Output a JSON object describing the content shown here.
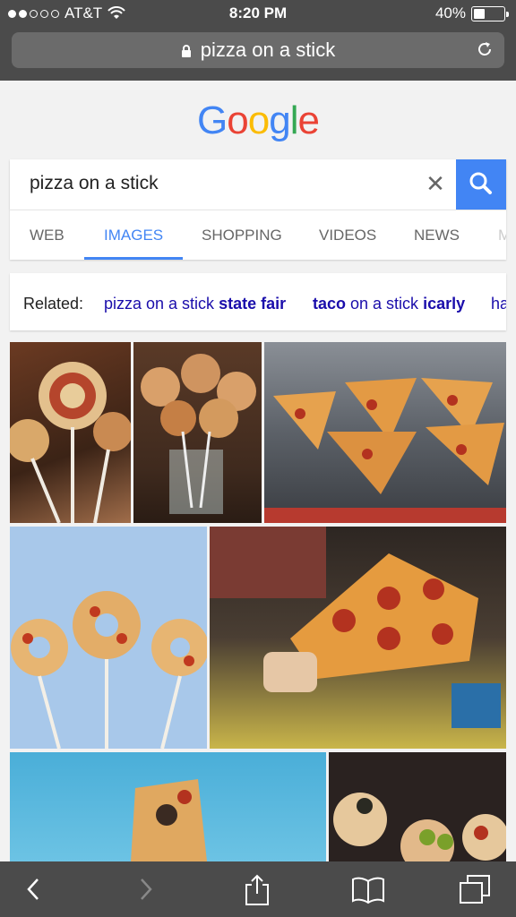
{
  "status": {
    "carrier": "AT&T",
    "time": "8:20 PM",
    "battery": "40%",
    "battery_level": 0.4
  },
  "url": {
    "text": "pizza on a stick"
  },
  "logo": {
    "letters": [
      "G",
      "o",
      "o",
      "g",
      "l",
      "e"
    ],
    "colors": [
      "#4285f4",
      "#ea4335",
      "#fbbc05",
      "#4285f4",
      "#34a853",
      "#ea4335"
    ]
  },
  "search": {
    "query": "pizza on a stick",
    "clear_icon": "close-icon",
    "search_icon": "search-icon"
  },
  "tabs": [
    {
      "label": "WEB",
      "active": false
    },
    {
      "label": "IMAGES",
      "active": true
    },
    {
      "label": "SHOPPING",
      "active": false
    },
    {
      "label": "VIDEOS",
      "active": false
    },
    {
      "label": "NEWS",
      "active": false
    },
    {
      "label": "M",
      "active": false
    }
  ],
  "related": {
    "label": "Related:",
    "items": [
      {
        "plain": "pizza on a stick ",
        "bold": "state fair"
      },
      {
        "bold_first": "taco",
        "plain": " on a stick ",
        "bold": "icarly"
      },
      {
        "plain": "ha"
      }
    ]
  },
  "accent": "#4285f4",
  "toolbar": [
    "back-icon",
    "forward-icon",
    "share-icon",
    "bookmarks-icon",
    "tabs-icon"
  ]
}
